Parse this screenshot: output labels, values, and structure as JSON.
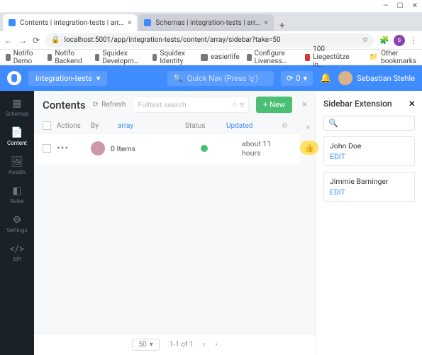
{
  "window": {
    "min": "—",
    "max": "☐",
    "close": "✕"
  },
  "tabs": {
    "t1": "Contents | integration-tests | arr…",
    "t2": "Schemas | integration-tests | arr…",
    "plus": "+"
  },
  "addr": {
    "lock": "🔒",
    "url": "localhost:5001/app/integration-tests/content/array/sidebar?take=50",
    "star": "☆"
  },
  "bookmarks": {
    "b1": "Notifo Demo",
    "b2": "Notifo Backend",
    "b3": "Squidex Developm…",
    "b4": "Squidex Identity",
    "b5": "easierlife",
    "b6": "Configure Liveness…",
    "b7": "100 Liegestütze in…",
    "other": "Other bookmarks"
  },
  "header": {
    "app": "integration-tests",
    "caret": "▾",
    "quicknav_icon": "🔍",
    "quicknav": "Quick Nav (Press 'q')",
    "sync_icon": "⟳",
    "sync_badge": "0",
    "sync_caret": "▾",
    "bell": "🔔",
    "user": "Sebastian Stehle"
  },
  "sidebar": {
    "items": [
      {
        "icon": "▦",
        "label": "Schemas"
      },
      {
        "icon": "📄",
        "label": "Content"
      },
      {
        "icon": "🖼",
        "label": "Assets"
      },
      {
        "icon": "�számí",
        "label": "Rules"
      },
      {
        "icon": "⚙",
        "label": "Settings"
      },
      {
        "icon": "API",
        "label": "API"
      }
    ],
    "rules_icon": "◧",
    "api_icon": "</>"
  },
  "contents": {
    "title": "Contents",
    "refresh_icon": "⟳",
    "refresh": "Refresh",
    "search_ph": "Fulltext search",
    "star": "☆",
    "filter": "≡",
    "new": "+ New",
    "close": "×",
    "cols": {
      "actions": "Actions",
      "by": "By",
      "array": "array",
      "status": "Status",
      "updated": "Updated",
      "gear": "⚙"
    },
    "funnel": "⚗",
    "row": {
      "dots": "•••",
      "text": "0 Items",
      "time": "about 11 hours"
    },
    "thumb": "👍"
  },
  "pager": {
    "size": "50",
    "caret": "▾",
    "range": "1-1 of 1",
    "prev": "‹",
    "next": "›"
  },
  "ext": {
    "title": "Sidebar Extension",
    "close": "×",
    "search": "🔍",
    "cards": [
      {
        "name": "John Doe",
        "edit": "EDIT"
      },
      {
        "name": "Jimmie Barninger",
        "edit": "EDIT"
      }
    ]
  }
}
